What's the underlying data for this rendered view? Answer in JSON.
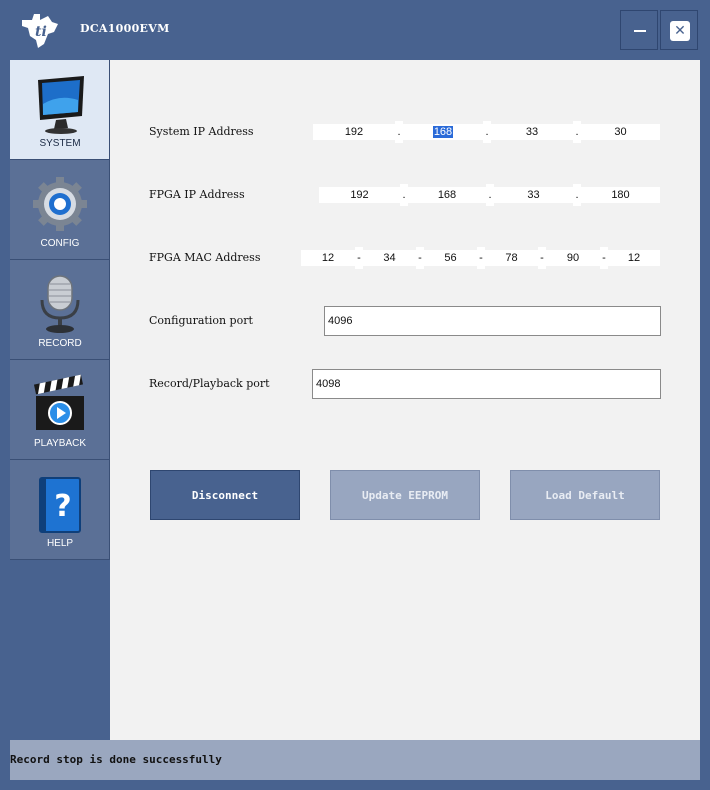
{
  "window": {
    "title": "DCA1000EVM",
    "logo_icon": "ti-logo-icon",
    "minimize_icon": "minimize-icon",
    "close_icon": "close-icon",
    "close_glyph": "✕"
  },
  "sidebar": {
    "items": [
      {
        "label": "SYSTEM",
        "icon": "monitor-icon",
        "active": true
      },
      {
        "label": "CONFIG",
        "icon": "gear-icon",
        "active": false
      },
      {
        "label": "RECORD",
        "icon": "microphone-icon",
        "active": false
      },
      {
        "label": "PLAYBACK",
        "icon": "clapperboard-icon",
        "active": false
      },
      {
        "label": "HELP",
        "icon": "help-book-icon",
        "active": false
      }
    ]
  },
  "system": {
    "system_ip": {
      "label": "System IP Address",
      "octets": [
        "192",
        "168",
        "33",
        "30"
      ],
      "separator": ".",
      "selected_octet": 1
    },
    "fpga_ip": {
      "label": "FPGA IP Address",
      "octets": [
        "192",
        "168",
        "33",
        "180"
      ],
      "separator": "."
    },
    "fpga_mac": {
      "label": "FPGA MAC Address",
      "octets": [
        "12",
        "34",
        "56",
        "78",
        "90",
        "12"
      ],
      "separator": "-"
    },
    "config_port": {
      "label": "Configuration port",
      "value": "4096"
    },
    "record_port": {
      "label": "Record/Playback port",
      "value": "4098"
    }
  },
  "buttons": {
    "disconnect": "Disconnect",
    "update_eeprom": "Update EEPROM",
    "load_default": "Load Default"
  },
  "status": {
    "message": "Record stop is done successfully"
  },
  "colors": {
    "chrome": "#48628f",
    "panel": "#f2f2f2",
    "selection": "#2a6ad8",
    "disabled_button": "#98a6c0"
  }
}
